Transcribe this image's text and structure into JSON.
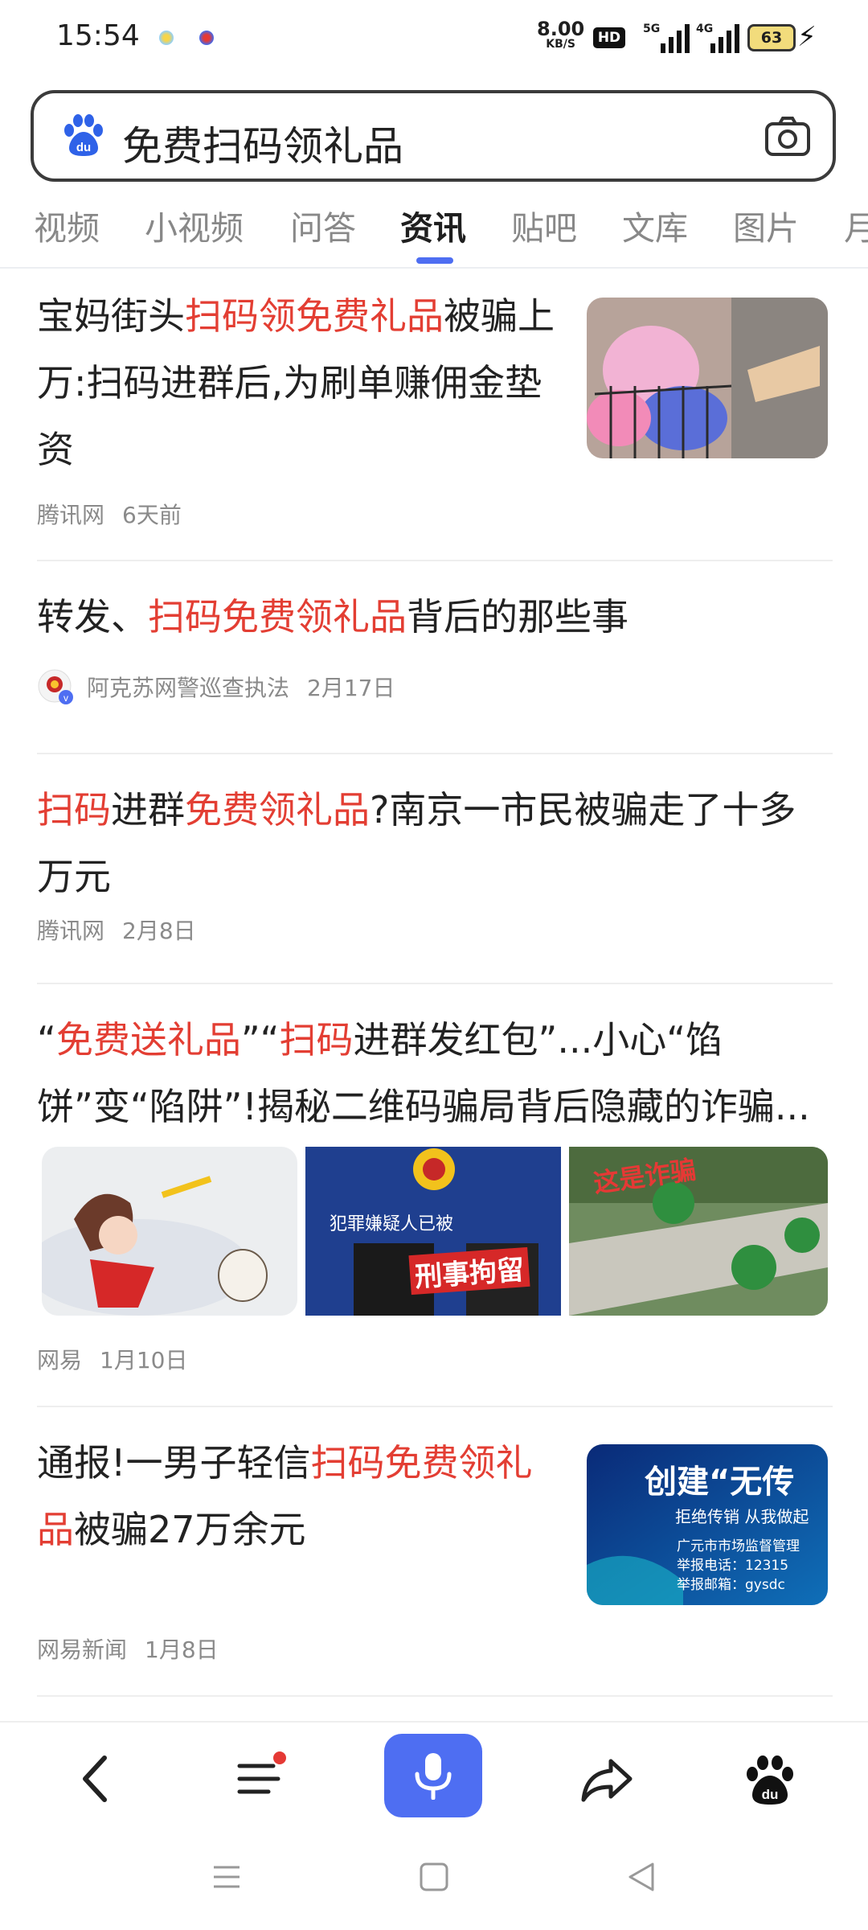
{
  "status_bar": {
    "time": "15:54",
    "net_speed_value": "8.00",
    "net_speed_unit": "KB/S",
    "hd_label": "HD",
    "network1": "5G",
    "network2": "4G",
    "battery": "63"
  },
  "search": {
    "query": "免费扫码领礼品",
    "logo_icon": "baidu-paw-icon",
    "camera_icon": "camera-icon"
  },
  "tabs": [
    "视频",
    "小视频",
    "问答",
    "资讯",
    "贴吧",
    "文库",
    "图片",
    "月"
  ],
  "active_tab": "资讯",
  "results": [
    {
      "title_parts": [
        {
          "text": "宝妈街头",
          "hl": false
        },
        {
          "text": "扫码领免费礼品",
          "hl": true
        },
        {
          "text": "被骗上万:扫码进群后,为刷单赚佣金垫资",
          "hl": false
        }
      ],
      "source": "腾讯网",
      "time": "6天前"
    },
    {
      "title_parts": [
        {
          "text": "转发、",
          "hl": false
        },
        {
          "text": "扫码免费领礼品",
          "hl": true
        },
        {
          "text": "背后的那些事",
          "hl": false
        }
      ],
      "source": "阿克苏网警巡查执法",
      "time": "2月17日"
    },
    {
      "title_parts": [
        {
          "text": "扫码",
          "hl": true
        },
        {
          "text": "进群",
          "hl": false
        },
        {
          "text": "免费领礼品",
          "hl": true
        },
        {
          "text": "?南京一市民被骗走了十多万元",
          "hl": false
        }
      ],
      "source": "腾讯网",
      "time": "2月8日"
    },
    {
      "title_parts": [
        {
          "text": "“",
          "hl": false
        },
        {
          "text": "免费送礼品",
          "hl": true
        },
        {
          "text": "”“",
          "hl": false
        },
        {
          "text": "扫码",
          "hl": true
        },
        {
          "text": "进群发红包”...小心“馅饼”变“陷阱”!揭秘二维码骗局背后隐藏的诈骗...",
          "hl": false
        }
      ],
      "image_texts": [
        "犯罪嫌疑人已被",
        "刑事拘留",
        "这是诈骗"
      ],
      "source": "网易",
      "time": "1月10日"
    },
    {
      "title_parts": [
        {
          "text": "通报!一男子轻信",
          "hl": false
        },
        {
          "text": "扫码免费领礼品",
          "hl": true
        },
        {
          "text": "被骗27万余元",
          "hl": false
        }
      ],
      "image_texts": [
        "创建“无传",
        "拒绝传销 从我做起",
        "广元市市场监督管理",
        "举报电话：12315",
        "举报邮箱：gysdc"
      ],
      "source": "网易新闻",
      "time": "1月8日"
    }
  ],
  "bottom_nav": [
    "back-icon",
    "menu-icon",
    "microphone-icon",
    "share-icon",
    "baidu-paw-icon"
  ],
  "colors": {
    "accent": "#4e6ef2",
    "highlight": "#e33e33"
  }
}
